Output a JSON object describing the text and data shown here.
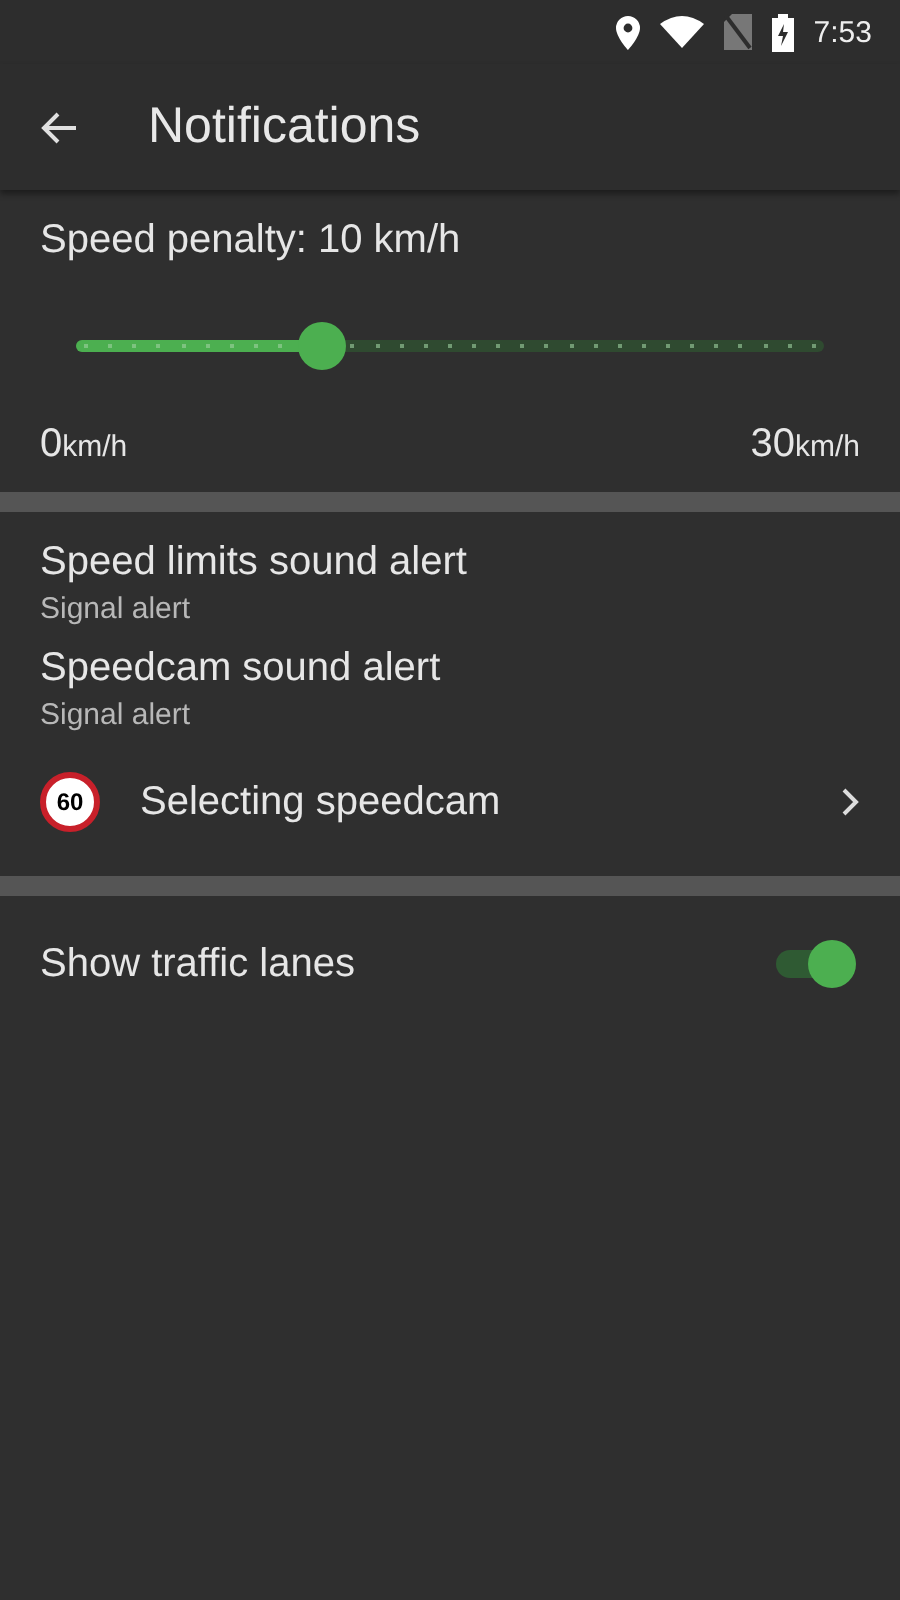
{
  "status_bar": {
    "time": "7:53"
  },
  "toolbar": {
    "title": "Notifications"
  },
  "speed_penalty": {
    "label": "Speed penalty: 10 km/h",
    "level": 0.33,
    "min": {
      "value": "0",
      "unit": "km/h"
    },
    "max": {
      "value": "30",
      "unit": "km/h"
    }
  },
  "alerts": [
    {
      "title": "Speed limits sound alert",
      "subtitle": "Signal alert"
    },
    {
      "title": "Speedcam sound alert",
      "subtitle": "Signal alert"
    }
  ],
  "speedcam_link": {
    "sign": "60",
    "label": "Selecting speedcam"
  },
  "traffic_lanes": {
    "label": "Show traffic lanes",
    "on": true
  }
}
